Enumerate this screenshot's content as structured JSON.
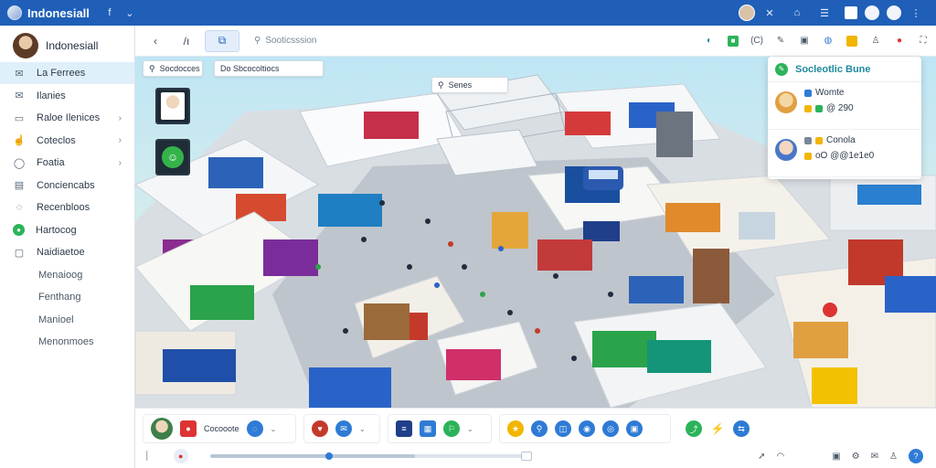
{
  "app": {
    "title": "Indonesiall",
    "chevron": "⌄"
  },
  "sidebar": {
    "user_name": "Indonesiall",
    "items": [
      {
        "label": "La Ferrees",
        "icon": "mail-icon",
        "active": true
      },
      {
        "label": "Ilanies",
        "icon": "mail-icon"
      },
      {
        "label": "Raloe Ilenices",
        "icon": "doc-icon",
        "chevron": true
      },
      {
        "label": "Coteclos",
        "icon": "thumb-icon",
        "chevron": true
      },
      {
        "label": "Foatia",
        "icon": "shield-icon",
        "chevron": true
      },
      {
        "label": "Conciencabs",
        "icon": "page-icon"
      },
      {
        "label": "Recenbloos",
        "icon": "chat-icon"
      },
      {
        "label": "Hartocog",
        "icon": "green-dot-icon"
      },
      {
        "label": "Naidiaetoe",
        "icon": "square-icon"
      },
      {
        "label": "Menaioog",
        "sub": true
      },
      {
        "label": "Fenthang",
        "sub": true
      },
      {
        "label": "Manioel",
        "sub": true
      },
      {
        "label": "Menonmoes",
        "sub": true
      }
    ]
  },
  "toolbar": {
    "search_text": "Sooticsssion",
    "right_text": "(C)"
  },
  "viewport": {
    "search_left": "Socdocces",
    "search_mid": "Do Sbcocoltiocs",
    "search_center": "Senes"
  },
  "panel": {
    "title": "Socleotlic Bune",
    "card1_line1": "Womte",
    "card1_line2": "@ 290",
    "card2_line1": "Conola",
    "card2_line2": "oO @@1e1e0"
  },
  "bottombar": {
    "label1": "Cocooote"
  },
  "colors": {
    "titlebar": "#1f5fb8",
    "accent": "#2e7bd6",
    "green": "#2cb35a"
  }
}
